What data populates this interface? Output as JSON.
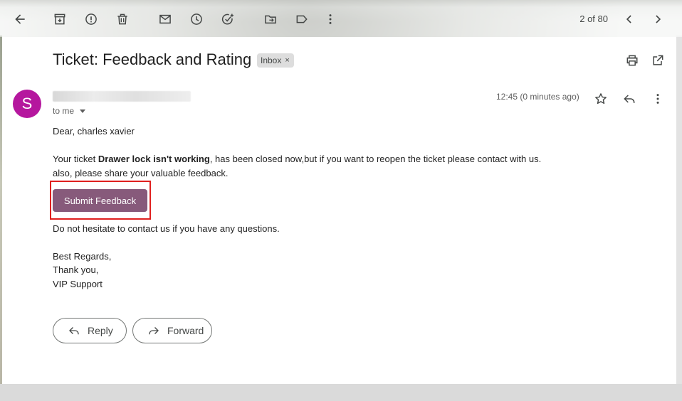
{
  "toolbar": {
    "pager": "2 of 80",
    "icons": [
      "back-arrow-icon",
      "archive-icon",
      "report-spam-icon",
      "delete-icon",
      "mark-unread-icon",
      "snooze-icon",
      "add-task-icon",
      "move-to-icon",
      "label-icon",
      "more-vert-icon",
      "chevron-left-icon",
      "chevron-right-icon"
    ]
  },
  "message": {
    "subject": "Ticket: Feedback and Rating",
    "label_chip": "Inbox",
    "label_chip_close": "×",
    "avatar_letter": "S",
    "to_me": "to me",
    "time": "12:45 (0 minutes ago)",
    "greeting": "Dear, charles xavier",
    "para1_prefix": "Your ticket ",
    "para1_bold": "Drawer lock isn't working",
    "para1_suffix": ", has been closed now,but if you want to reopen the ticket please contact with us.",
    "para2": "also, please share your valuable feedback.",
    "feedback_button": "Submit Feedback",
    "contact_line": "Do not hesitate to contact us if you have any questions.",
    "sign1": "Best Regards,",
    "sign2": "Thank you,",
    "sign3": "VIP Support"
  },
  "actions": {
    "reply": "Reply",
    "forward": "Forward"
  },
  "colors": {
    "avatar": "#b5179e",
    "feedback_button": "#875a7b",
    "highlight_box": "#e0201f"
  }
}
